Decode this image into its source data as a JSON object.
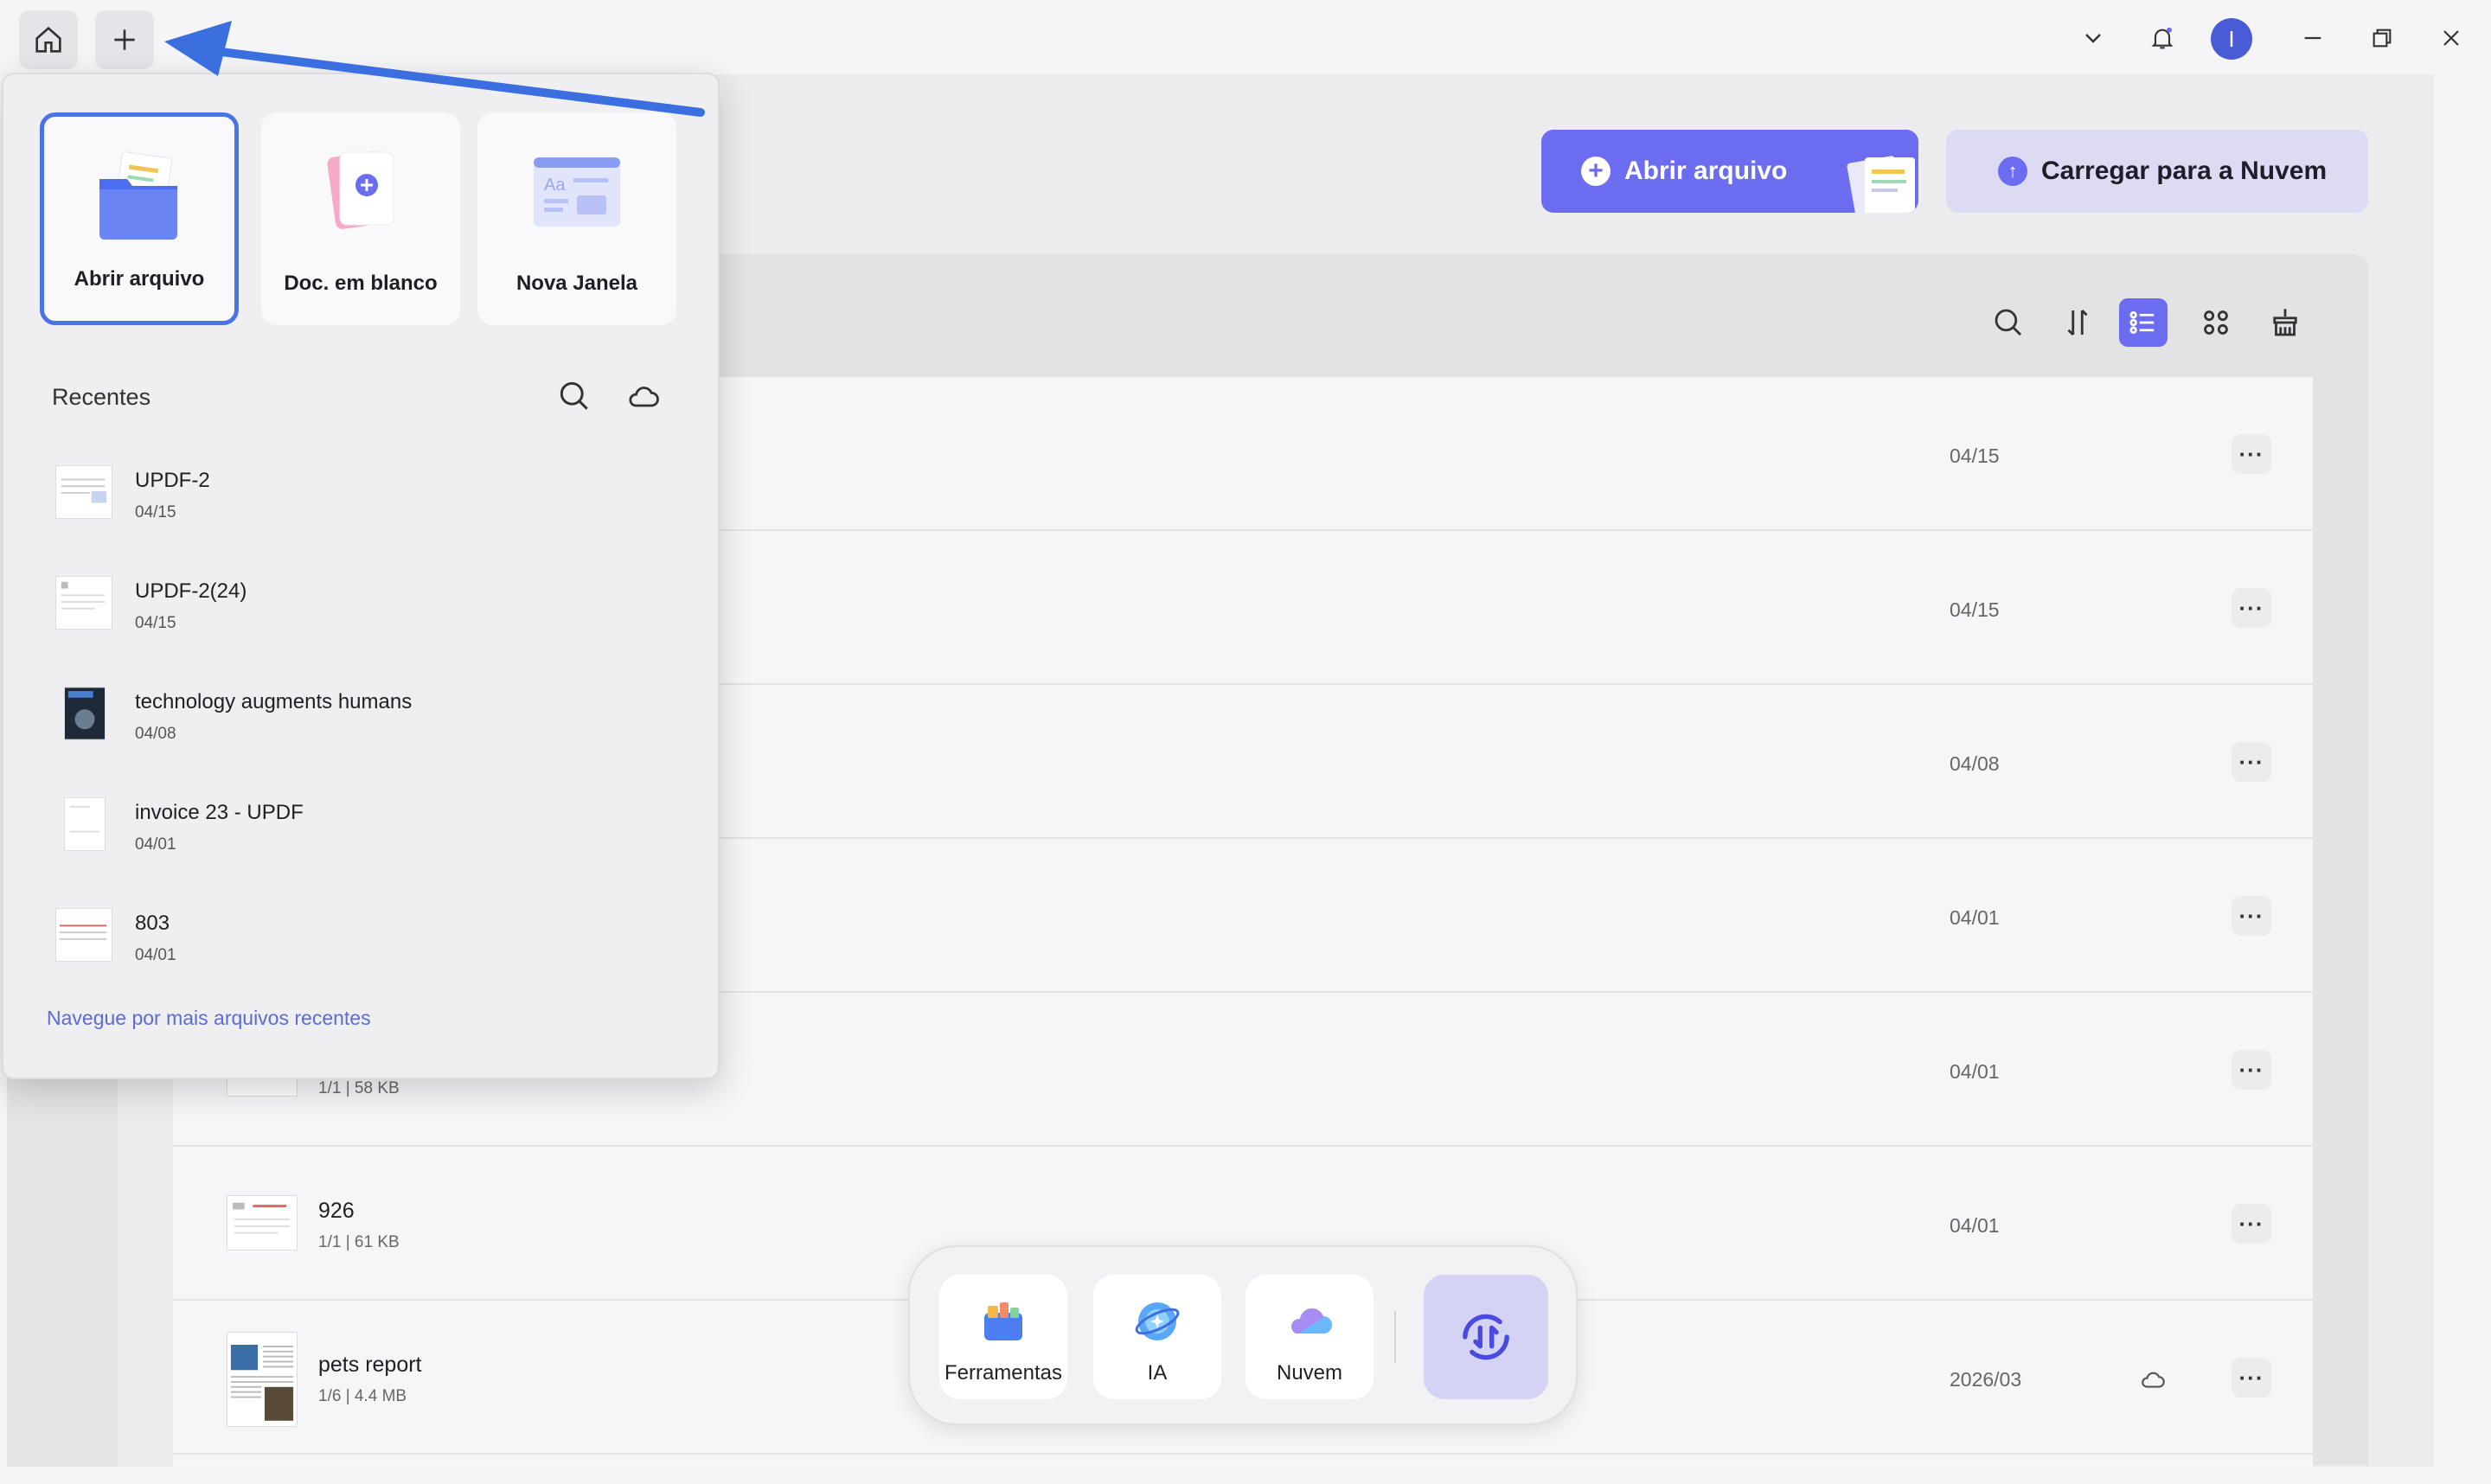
{
  "topbar": {
    "home_icon": "home-icon",
    "new_tab_icon": "plus-icon",
    "dropdown_icon": "chevron-down-icon",
    "notification_icon": "bell-icon",
    "avatar_letter": "I",
    "accent": "#4a5bd8"
  },
  "header_buttons": {
    "open_file": "Abrir arquivo",
    "upload_cloud": "Carregar para a Nuvem"
  },
  "toolbar": {
    "search_icon": "search-icon",
    "sort_icon": "sort-icon",
    "list_view_icon": "list-view-icon",
    "grid_view_icon": "grid-view-icon",
    "clean_icon": "broom-icon"
  },
  "files": [
    {
      "name": "",
      "meta": "",
      "date": "04/15"
    },
    {
      "name": "",
      "meta": "",
      "date": "04/15"
    },
    {
      "name": "",
      "meta": "",
      "date": "04/08"
    },
    {
      "name": "",
      "meta": "",
      "date": "04/01"
    },
    {
      "name": "",
      "meta": "1/1 | 58 KB",
      "date": "04/01"
    },
    {
      "name": "926",
      "meta": "1/1 | 61 KB",
      "date": "04/01"
    },
    {
      "name": "pets report",
      "meta": "1/6 | 4.4 MB",
      "date": "2026/03",
      "cloud": true
    }
  ],
  "more_label": "···",
  "dock": {
    "tools": "Ferramentas",
    "ai": "IA",
    "cloud": "Nuvem"
  },
  "popup": {
    "cards": {
      "open": "Abrir arquivo",
      "blank": "Doc. em blanco",
      "window": "Nova Janela"
    },
    "recent_title": "Recentes",
    "recent": [
      {
        "name": "UPDF-2",
        "date": "04/15"
      },
      {
        "name": "UPDF-2(24)",
        "date": "04/15"
      },
      {
        "name": "technology augments humans",
        "date": "04/08"
      },
      {
        "name": "invoice 23 - UPDF",
        "date": "04/01"
      },
      {
        "name": "803",
        "date": "04/01"
      }
    ],
    "browse_more": "Navegue por mais arquivos recentes"
  },
  "colors": {
    "primary": "#6c6cf0",
    "selection": "#4a73e8",
    "arrow": "#3b6fe0"
  }
}
